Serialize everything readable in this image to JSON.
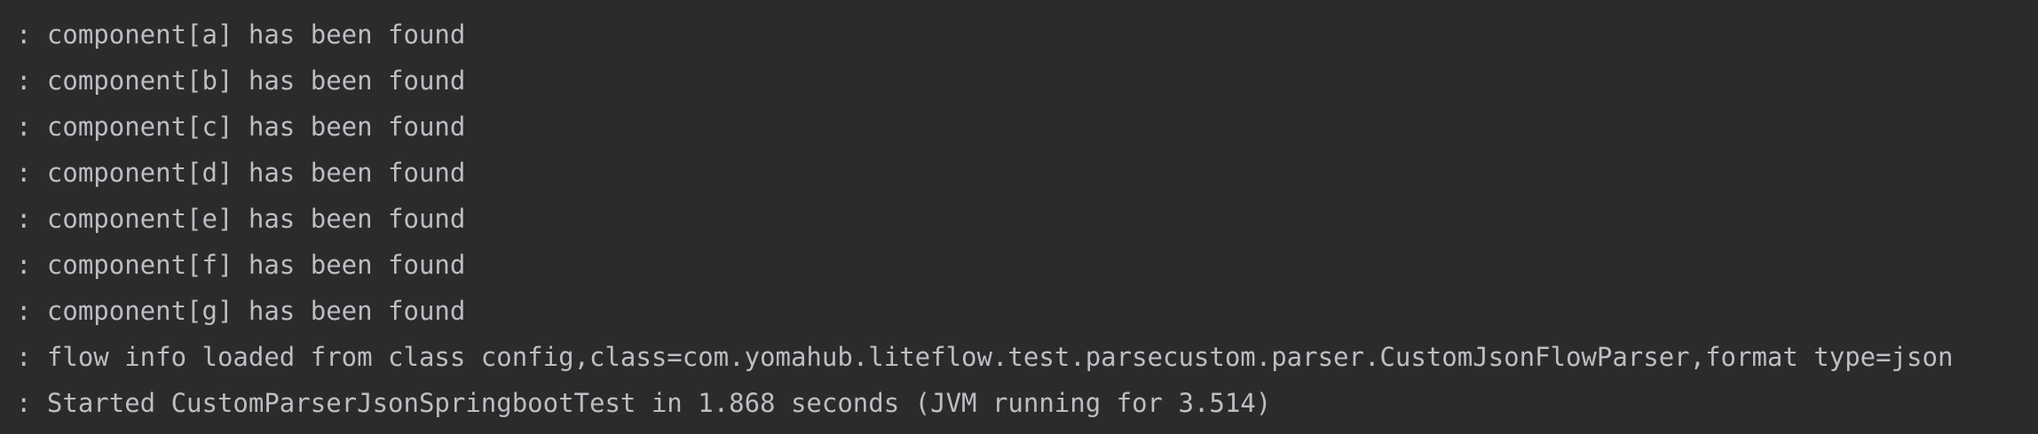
{
  "console": {
    "lines": [
      ": component[a] has been found",
      ": component[b] has been found",
      ": component[c] has been found",
      ": component[d] has been found",
      ": component[e] has been found",
      ": component[f] has been found",
      ": component[g] has been found",
      ": flow info loaded from class config,class=com.yomahub.liteflow.test.parsecustom.parser.CustomJsonFlowParser,format type=json",
      ": Started CustomParserJsonSpringbootTest in 1.868 seconds (JVM running for 3.514)"
    ]
  }
}
